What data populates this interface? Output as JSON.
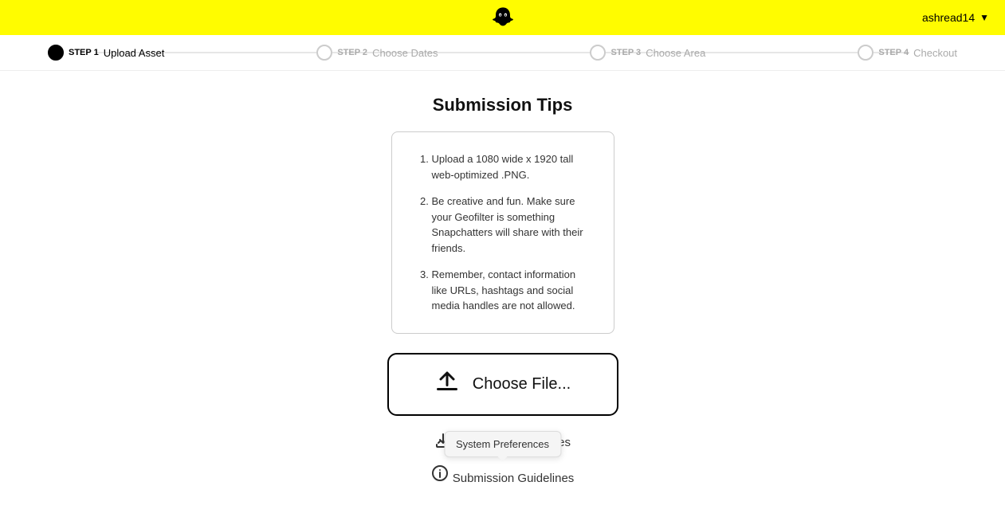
{
  "header": {
    "username": "ashread14",
    "logo_alt": "Snapchat logo"
  },
  "steps": [
    {
      "num": "STEP 1",
      "name": "Upload Asset",
      "active": true
    },
    {
      "num": "STEP 2",
      "name": "Choose Dates",
      "active": false
    },
    {
      "num": "STEP 3",
      "name": "Choose Area",
      "active": false
    },
    {
      "num": "STEP 4",
      "name": "Checkout",
      "active": false
    }
  ],
  "main": {
    "title": "Submission Tips",
    "tips": [
      "Upload a 1080 wide x 1920 tall web-optimized .PNG.",
      "Be creative and fun. Make sure your Geofilter is something Snapchatters will share with their friends.",
      "Remember, contact information like URLs, hashtags and social media handles are not allowed."
    ],
    "choose_file_label": "Choose File...",
    "download_templates_label": "Download Templates",
    "submission_guidelines_label": "Submission Guidelines",
    "tooltip_text": "System Preferences"
  }
}
